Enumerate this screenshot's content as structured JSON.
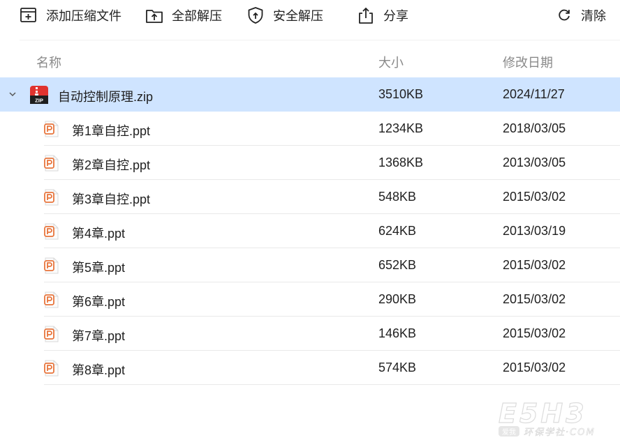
{
  "toolbar": {
    "add_label": "添加压缩文件",
    "extract_all_label": "全部解压",
    "safe_extract_label": "安全解压",
    "share_label": "分享",
    "clear_label": "清除"
  },
  "columns": {
    "name": "名称",
    "size": "大小",
    "date": "修改日期"
  },
  "archive": {
    "name": "自动控制原理.zip",
    "size": "3510KB",
    "date": "2024/11/27",
    "badge": "ZIP"
  },
  "files": [
    {
      "name": "第1章自控.ppt",
      "size": "1234KB",
      "date": "2018/03/05"
    },
    {
      "name": "第2章自控.ppt",
      "size": "1368KB",
      "date": "2013/03/05"
    },
    {
      "name": "第3章自控.ppt",
      "size": "548KB",
      "date": "2015/03/02"
    },
    {
      "name": "第4章.ppt",
      "size": "624KB",
      "date": "2013/03/19"
    },
    {
      "name": "第5章.ppt",
      "size": "652KB",
      "date": "2015/03/02"
    },
    {
      "name": "第6章.ppt",
      "size": "290KB",
      "date": "2015/03/02"
    },
    {
      "name": "第7章.ppt",
      "size": "146KB",
      "date": "2015/03/02"
    },
    {
      "name": "第8章.ppt",
      "size": "574KB",
      "date": "2015/03/02"
    }
  ],
  "watermark": {
    "logo": "E5H3",
    "tagline": "环保学社·COM",
    "seal": "爱我"
  },
  "colors": {
    "selected_row": "#cfe4ff",
    "ppt_orange": "#e8743b",
    "zip_red": "#e0332e",
    "header_text": "#8a8a8a"
  }
}
